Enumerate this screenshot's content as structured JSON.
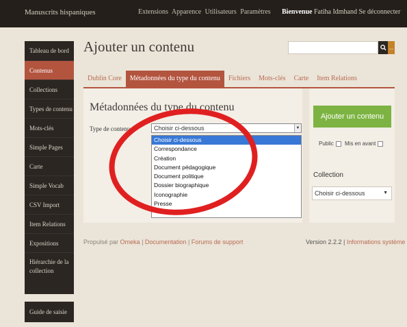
{
  "topbar": {
    "site_title": "Manuscrits hispaniques",
    "nav": [
      "Extensions",
      "Apparence",
      "Utilisateurs",
      "Paramètres"
    ],
    "welcome": "Bienvenue",
    "user_name": "Fatiha Idmhand",
    "logout": "Se déconnecter"
  },
  "sidebar": {
    "items": [
      {
        "label": "Tableau de bord"
      },
      {
        "label": "Contenus"
      },
      {
        "label": "Collections"
      },
      {
        "label": "Types de contenu"
      },
      {
        "label": "Mots-clés"
      },
      {
        "label": "Simple Pages"
      },
      {
        "label": "Carte"
      },
      {
        "label": "Simple Vocab"
      },
      {
        "label": "CSV Import"
      },
      {
        "label": "Item Relations"
      },
      {
        "label": "Expositions"
      },
      {
        "label": "Hiérarchie de la collection"
      }
    ],
    "active_index": 1,
    "guide": "Guide de saisie"
  },
  "main": {
    "title": "Ajouter un contenu",
    "search_icon": "search-icon",
    "search_more": "...",
    "tabs": [
      {
        "label": "Dublin Core"
      },
      {
        "label": "Métadonnées du type du contenu"
      },
      {
        "label": "Fichiers"
      },
      {
        "label": "Mots-clés"
      },
      {
        "label": "Carte"
      },
      {
        "label": "Item Relations"
      }
    ],
    "active_tab": 1,
    "section_title": "Métadonnées du type du contenu",
    "field_label": "Type de contenu",
    "select_value": "Choisir ci-dessous",
    "options": [
      "Choisir ci-dessous",
      "Correspondance",
      "Création",
      "Document pédagogique",
      "Document politique",
      "Dossier biographique",
      "Iconographie",
      "Presse"
    ],
    "selected_option_index": 0
  },
  "side_panel": {
    "add_button": "Ajouter un contenu",
    "public_label": "Public",
    "featured_label": "Mis en avant",
    "collection_label": "Collection",
    "collection_value": "Choisir ci-dessous"
  },
  "footer": {
    "powered": "Propulsé par",
    "omeka": "Omeka",
    "documentation": "Documentation",
    "forums": "Forums de support",
    "version": "Version 2.2.2",
    "system_info": "Informations système"
  },
  "colors": {
    "accent": "#b3543f",
    "dark": "#2b2622",
    "green": "#7cb342",
    "annotation_circle": "#e02020"
  }
}
